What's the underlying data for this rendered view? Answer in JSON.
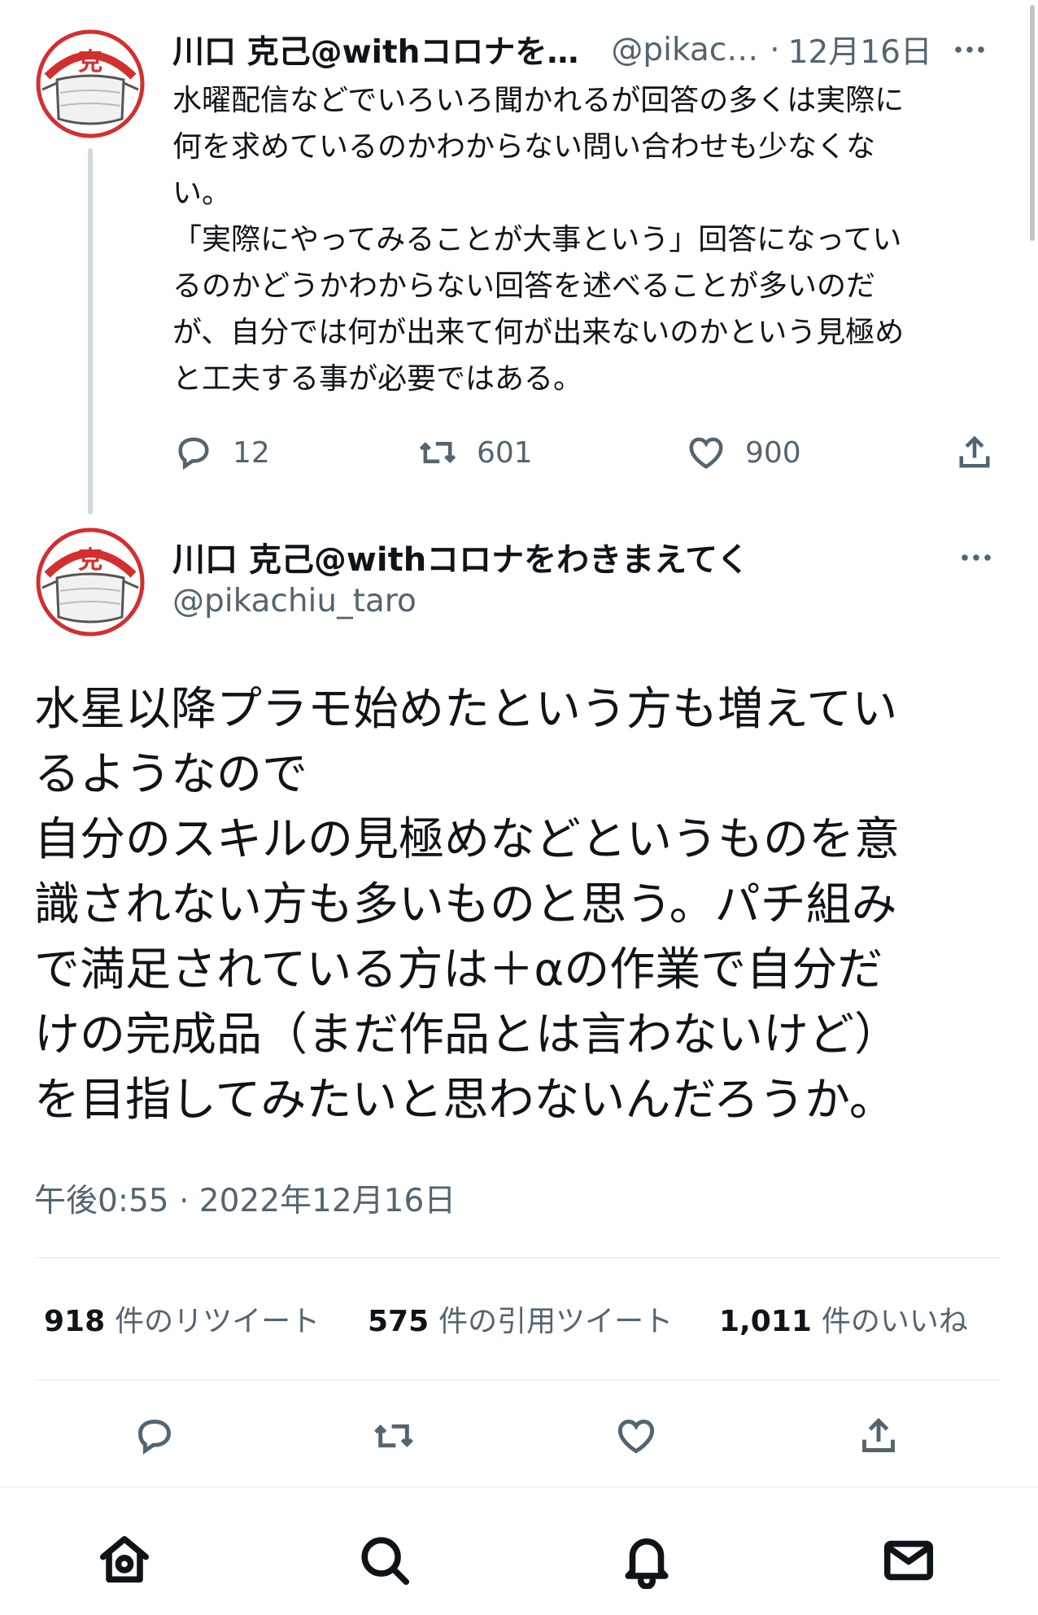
{
  "colors": {
    "text": "#0f1419",
    "secondary": "#536471",
    "divider": "#eff3f4",
    "thread_line": "#cfd9de",
    "avatar_red": "#d32f2f"
  },
  "avatar": {
    "glyph": "克",
    "icon": "mask-avatar-icon"
  },
  "parent_tweet": {
    "name": "川口 克己@withコロナを…",
    "handle": "@pikac…",
    "dot": "·",
    "date": "12月16日",
    "lines": [
      "水曜配信などでいろいろ聞かれるが回答の多くは実際に",
      "何を求めているのかわからない問い合わせも少なくな",
      "い。",
      "「実際にやってみることが大事という」回答になってい",
      "るのかどうかわからない回答を述べることが多いのだ",
      "が、自分では何が出来て何が出来ないのかという見極め",
      "と工夫する事が必要ではある。"
    ],
    "actions": {
      "replies": "12",
      "retweets": "601",
      "likes": "900"
    }
  },
  "main_tweet": {
    "name": "川口 克己@withコロナをわきまえてく",
    "handle": "@pikachiu_taro",
    "lines": [
      "水星以降プラモ始めたという方も増えてい",
      "るようなので",
      "自分のスキルの見極めなどというものを意",
      "識されない方も多いものと思う。パチ組み",
      "で満足されている方は＋αの作業で自分だ",
      "けの完成品（まだ作品とは言わないけど）",
      "を目指してみたいと思わないんだろうか。"
    ],
    "timestamp": "午後0:55 · 2022年12月16日",
    "stats": {
      "retweets_count": "918",
      "retweets_label": "件のリツイート",
      "quotes_count": "575",
      "quotes_label": "件の引用ツイート",
      "likes_count": "1,011",
      "likes_label": "件のいいね"
    }
  },
  "nav": {
    "icons": [
      "home-icon",
      "search-icon",
      "notifications-icon",
      "messages-icon"
    ]
  }
}
